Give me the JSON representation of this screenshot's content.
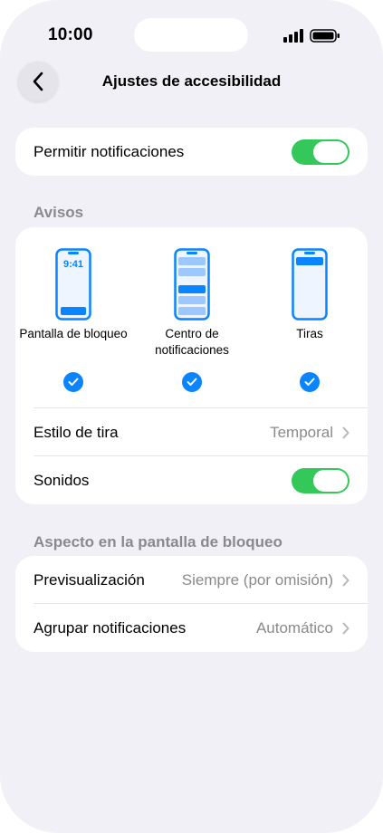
{
  "status_bar": {
    "time": "10:00"
  },
  "nav": {
    "title": "Ajustes de accesibilidad"
  },
  "allow_notifications": {
    "label": "Permitir notificaciones",
    "enabled": true
  },
  "alerts": {
    "header": "Avisos",
    "options": [
      {
        "label": "Pantalla de bloqueo",
        "checked": true,
        "preview_time": "9:41"
      },
      {
        "label_line1": "Centro de",
        "label_line2": "notificaciones",
        "checked": true
      },
      {
        "label": "Tiras",
        "checked": true
      }
    ],
    "banner_style": {
      "label": "Estilo de tira",
      "value": "Temporal"
    },
    "sounds": {
      "label": "Sonidos",
      "enabled": true
    }
  },
  "lock_screen": {
    "header": "Aspecto en la pantalla de bloqueo",
    "preview": {
      "label": "Previsualización",
      "value": "Siempre (por omisión)"
    },
    "grouping": {
      "label": "Agrupar notificaciones",
      "value": "Automático"
    }
  },
  "colors": {
    "accent": "#0a84ff",
    "toggle_on": "#34c759",
    "background": "#f0f0f6"
  }
}
